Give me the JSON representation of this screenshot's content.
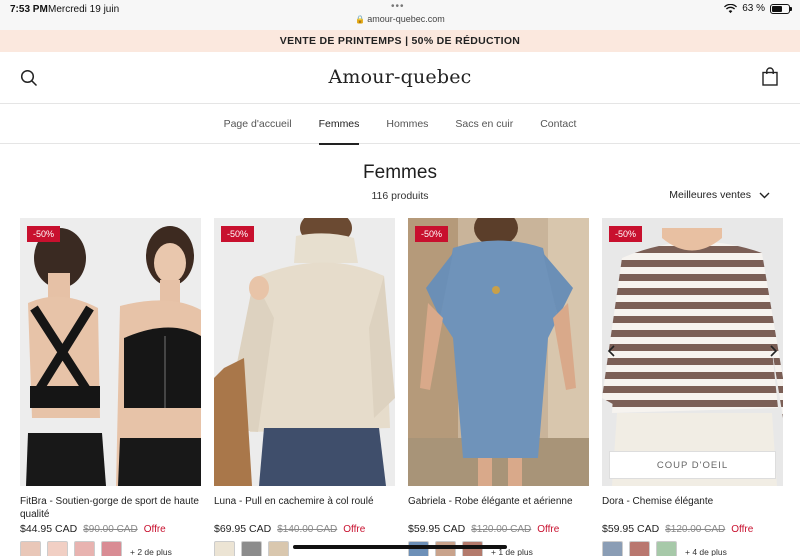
{
  "status": {
    "time": "7:53 PM",
    "date": "Mercredi 19 juin",
    "url": "amour-quebec.com",
    "battery": "63 %",
    "battery_level": 0.63
  },
  "promo": "VENTE DE PRINTEMPS | 50% DE RÉDUCTION",
  "header": {
    "logo": "Amour-quebec",
    "search_icon": "search-icon",
    "cart_icon": "shopping-bag-icon"
  },
  "nav": [
    "Page d'accueil",
    "Femmes",
    "Hommes",
    "Sacs en cuir",
    "Contact"
  ],
  "collection": {
    "title": "Femmes",
    "count": "116 produits",
    "sort": "Meilleures ventes"
  },
  "products": [
    {
      "badge": "-50%",
      "name": "FitBra - Soutien-gorge de sport de haute qualité",
      "price": "$44.95 CAD",
      "old_price": "$90.00 CAD",
      "offer": "Offre",
      "swatches": [
        "#e9c7b8",
        "#f1cfc4",
        "#e8b3b0",
        "#d98c94"
      ],
      "more": "+ 2 de plus"
    },
    {
      "badge": "-50%",
      "name": "Luna - Pull en cachemire à col roulé",
      "price": "$69.95 CAD",
      "old_price": "$140.00 CAD",
      "offer": "Offre",
      "swatches": [
        "#ece4d4",
        "#8c8c8c",
        "#d9c7ae"
      ],
      "more": ""
    },
    {
      "badge": "-50%",
      "name": "Gabriela - Robe élégante et aérienne",
      "price": "$59.95 CAD",
      "old_price": "$120.00 CAD",
      "offer": "Offre",
      "swatches": [
        "#6d90b8",
        "#c9a38c",
        "#b47a6c"
      ],
      "more": "+ 1 de plus"
    },
    {
      "badge": "-50%",
      "name": "Dora - Chemise élégante",
      "price": "$59.95 CAD",
      "old_price": "$120.00 CAD",
      "offer": "Offre",
      "swatches": [
        "#8a9db5",
        "#b9776f",
        "#a7c9a9"
      ],
      "more": "+ 4 de plus",
      "quick_view": "COUP D'OEIL"
    }
  ],
  "colors": {
    "promo_bg": "#fbe8de",
    "badge": "#c8102e",
    "offer": "#c8102e"
  }
}
